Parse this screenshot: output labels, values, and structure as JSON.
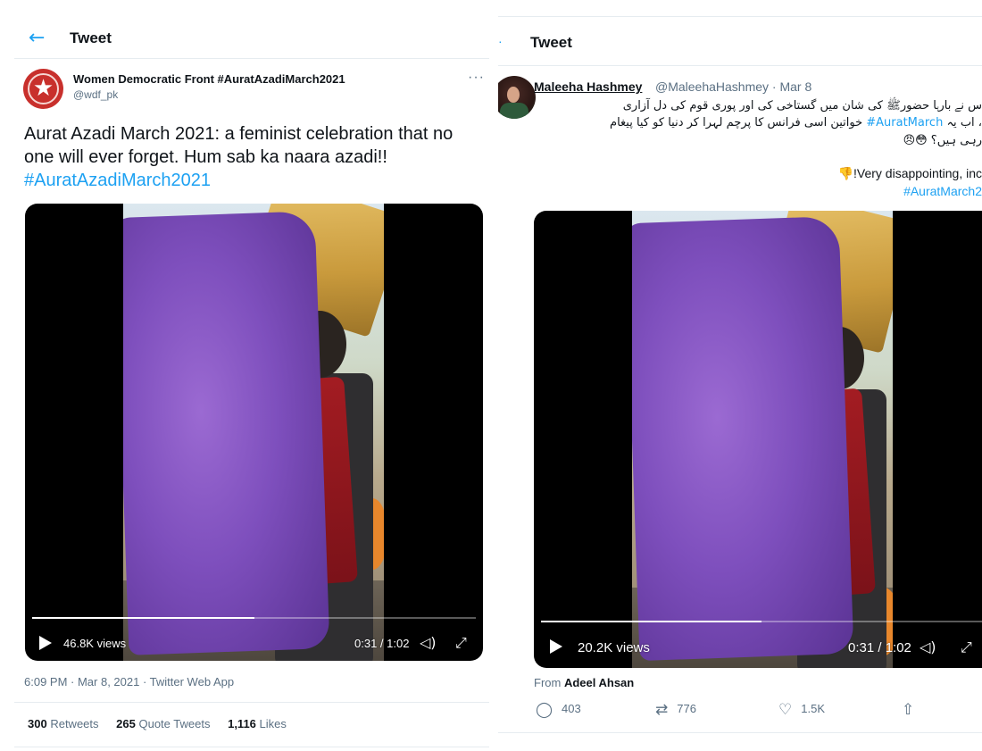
{
  "left_tweet": {
    "header_title": "Tweet",
    "author_name": "Women Democratic Front #AuratAzadiMarch2021",
    "author_handle": "@wdf_pk",
    "more_label": "···",
    "text": "Aurat Azadi March 2021: a feminist celebration that no one will ever forget. Hum sab ka naara azadi!!",
    "hashtag": "#AuratAzadiMarch2021",
    "video": {
      "views": "46.8K views",
      "time": "0:31 / 1:02",
      "progress_fraction": 0.5
    },
    "timestamp": "6:09 PM · Mar 8, 2021 · Twitter Web App",
    "stats": {
      "retweets_count": "300",
      "retweets_label": "Retweets",
      "quotes_count": "265",
      "quotes_label": "Quote Tweets",
      "likes_count": "1,116",
      "likes_label": "Likes"
    }
  },
  "right_tweet": {
    "header_title": "Tweet",
    "author_name": "Maleeha Hashmey",
    "author_handle_date": "@MaleehaHashmey · Mar 8",
    "urdu_line1": "س نے بارہا حضورﷺ کی شان میں گستاخی کی اور پوری قوم کی دل آزاری",
    "urdu_line2_pre": "، اب یہ ",
    "urdu_hashtag": "#AuratMarch",
    "urdu_line2_post": " خواتین اسی فرانس کا پرچم لہرا کر دنیا کو کیا پیغام",
    "urdu_line3": "رہی ہیں؟ 😳😠",
    "english_line": "👎!Very disappointing, inc",
    "hashtag_line": "#AuratMarch2",
    "video": {
      "views": "20.2K views",
      "time": "0:31 / 1:02",
      "progress_fraction": 0.5
    },
    "from_label": "From",
    "from_name": "Adeel Ahsan",
    "replies": "403",
    "retweets": "776",
    "likes": "1.5K"
  },
  "icons": {
    "back": "back-arrow-icon",
    "play": "play-icon",
    "volume": "volume-icon",
    "fullscreen": "fullscreen-icon",
    "reply": "reply-icon",
    "retweet": "retweet-icon",
    "like": "heart-icon",
    "share": "share-icon"
  },
  "colors": {
    "accent": "#1da1f2",
    "secondary_text": "#5b7083",
    "purple_cloth": "#7e4fbd",
    "avatar_red": "#c8302c"
  }
}
